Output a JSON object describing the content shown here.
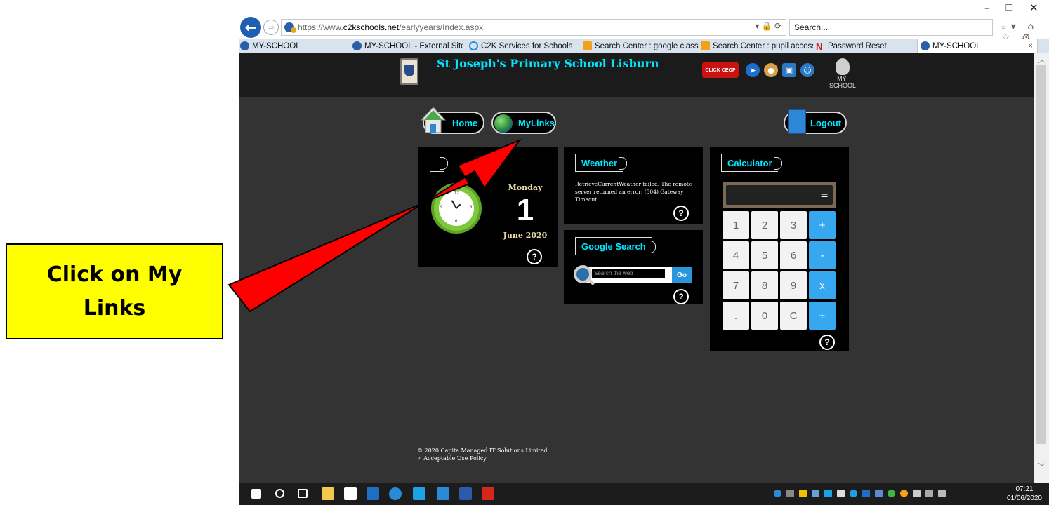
{
  "callout": {
    "text": "Click on My Links"
  },
  "window": {
    "minimize": "–",
    "restore": "❐",
    "close": "✕"
  },
  "address": {
    "url_prefix": "https://www.",
    "url_domain": "c2kschools.net",
    "url_path": "/earlyyears/Index.aspx",
    "tools": "▾ 🔒 ⟳",
    "search_placeholder": "Search...",
    "search_tools": "⌕▾ ⌂ ☆ ⚙"
  },
  "tabs": [
    {
      "label": "MY-SCHOOL",
      "icon": "site-icon"
    },
    {
      "label": "MY-SCHOOL - External Site",
      "icon": "site-icon"
    },
    {
      "label": "C2K Services for Schools",
      "icon": "ie-icon"
    },
    {
      "label": "Search Center : google classr...",
      "icon": "sharepoint-icon"
    },
    {
      "label": "Search Center : pupil accessi...",
      "icon": "sharepoint-icon"
    },
    {
      "label": "Password Reset",
      "icon": "n-icon"
    },
    {
      "label": "MY-SCHOOL",
      "icon": "site-icon",
      "active": true
    }
  ],
  "tab_close": "×",
  "header": {
    "school_name": "St Joseph's Primary School Lisburn",
    "ceop_label": "CLICK CEOP",
    "logo_text": "MY-SCHOOL"
  },
  "nav": {
    "home": "Home",
    "mylinks": "MyLinks",
    "logout": "Logout"
  },
  "clock": {
    "day": "Monday",
    "date": "1",
    "month_year": "June 2020"
  },
  "weather": {
    "title": "Weather",
    "message": "RetrieveCurrentWeather failed. The remote server returned an error: (504) Gateway Timeout."
  },
  "google": {
    "title": "Google Search",
    "placeholder": "Search the web",
    "go": "Go"
  },
  "calculator": {
    "title": "Calculator",
    "equals": "=",
    "keys": [
      "1",
      "2",
      "3",
      "+",
      "4",
      "5",
      "6",
      "-",
      "7",
      "8",
      "9",
      "x",
      ".",
      "0",
      "C",
      "÷"
    ]
  },
  "help": "?",
  "footer": {
    "copyright": "© 2020 Capita Managed IT Solutions Limited.",
    "policy": "Acceptable Use Policy"
  },
  "taskbar": {
    "time": "07:21",
    "date": "01/06/2020"
  },
  "colors": {
    "accent": "#00e6ff",
    "callout_bg": "#ffff00",
    "arrow": "#ff0000"
  }
}
